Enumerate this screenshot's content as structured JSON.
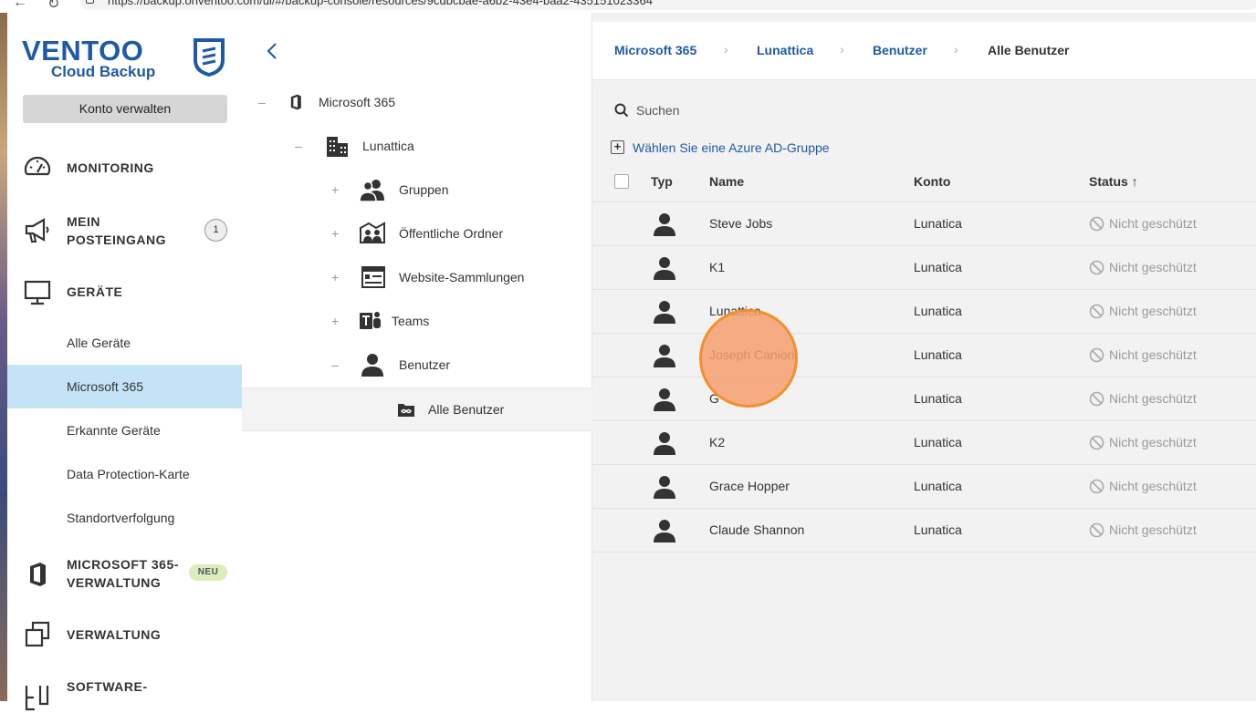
{
  "browser": {
    "url": "https://backup.onventoo.com/ui/#/backup-console/resources/9cdbcbae-a6b2-43e4-baa2-435151023364"
  },
  "sidebar": {
    "logo_top": "VENTOO",
    "logo_bottom": "Cloud Backup",
    "konto_button": "Konto verwalten",
    "monitoring": "MONITORING",
    "inbox_line1": "MEIN",
    "inbox_line2": "POSTEINGANG",
    "inbox_count": "1",
    "geraete": "GERÄTE",
    "sub_items": [
      "Alle Geräte",
      "Microsoft 365",
      "Erkannte Geräte",
      "Data Protection-Karte",
      "Standortverfolgung"
    ],
    "active_sub": "Microsoft 365",
    "m365_line1": "MICROSOFT 365-",
    "m365_line2": "VERWALTUNG",
    "m365_badge": "NEU",
    "verwaltung": "VERWALTUNG",
    "software": "SOFTWARE-"
  },
  "tree": {
    "root": "Microsoft 365",
    "org": "Lunattica",
    "gruppen": "Gruppen",
    "ordner": "Öffentliche Ordner",
    "sammlungen": "Website-Sammlungen",
    "teams": "Teams",
    "benutzer": "Benutzer",
    "alle_benutzer": "Alle Benutzer",
    "toggle_plus": "+",
    "toggle_minus": "–"
  },
  "breadcrumb": {
    "items": [
      "Microsoft 365",
      "Lunattica",
      "Benutzer",
      "Alle Benutzer"
    ],
    "separator": "›"
  },
  "search": {
    "placeholder": "Suchen"
  },
  "azure_link": "Wählen Sie eine Azure AD-Gruppe",
  "table": {
    "headers": {
      "typ": "Typ",
      "name": "Name",
      "konto": "Konto",
      "status": "Status ↑"
    },
    "rows": [
      {
        "name": "Steve Jobs",
        "konto": "Lunatica",
        "status": "Nicht geschützt"
      },
      {
        "name": "K1",
        "konto": "Lunatica",
        "status": "Nicht geschützt"
      },
      {
        "name": "Lunattica",
        "konto": "Lunatica",
        "status": "Nicht geschützt"
      },
      {
        "name": "Joseph Canion",
        "konto": "Lunatica",
        "status": "Nicht geschützt"
      },
      {
        "name": "G",
        "konto": "Lunatica",
        "status": "Nicht geschützt"
      },
      {
        "name": "K2",
        "konto": "Lunatica",
        "status": "Nicht geschützt"
      },
      {
        "name": "Grace Hopper",
        "konto": "Lunatica",
        "status": "Nicht geschützt"
      },
      {
        "name": "Claude Shannon",
        "konto": "Lunatica",
        "status": "Nicht geschützt"
      }
    ]
  },
  "colors": {
    "brand": "#1e5aa5",
    "active_bg": "#c5e3f6",
    "highlight": "#f2902c"
  }
}
